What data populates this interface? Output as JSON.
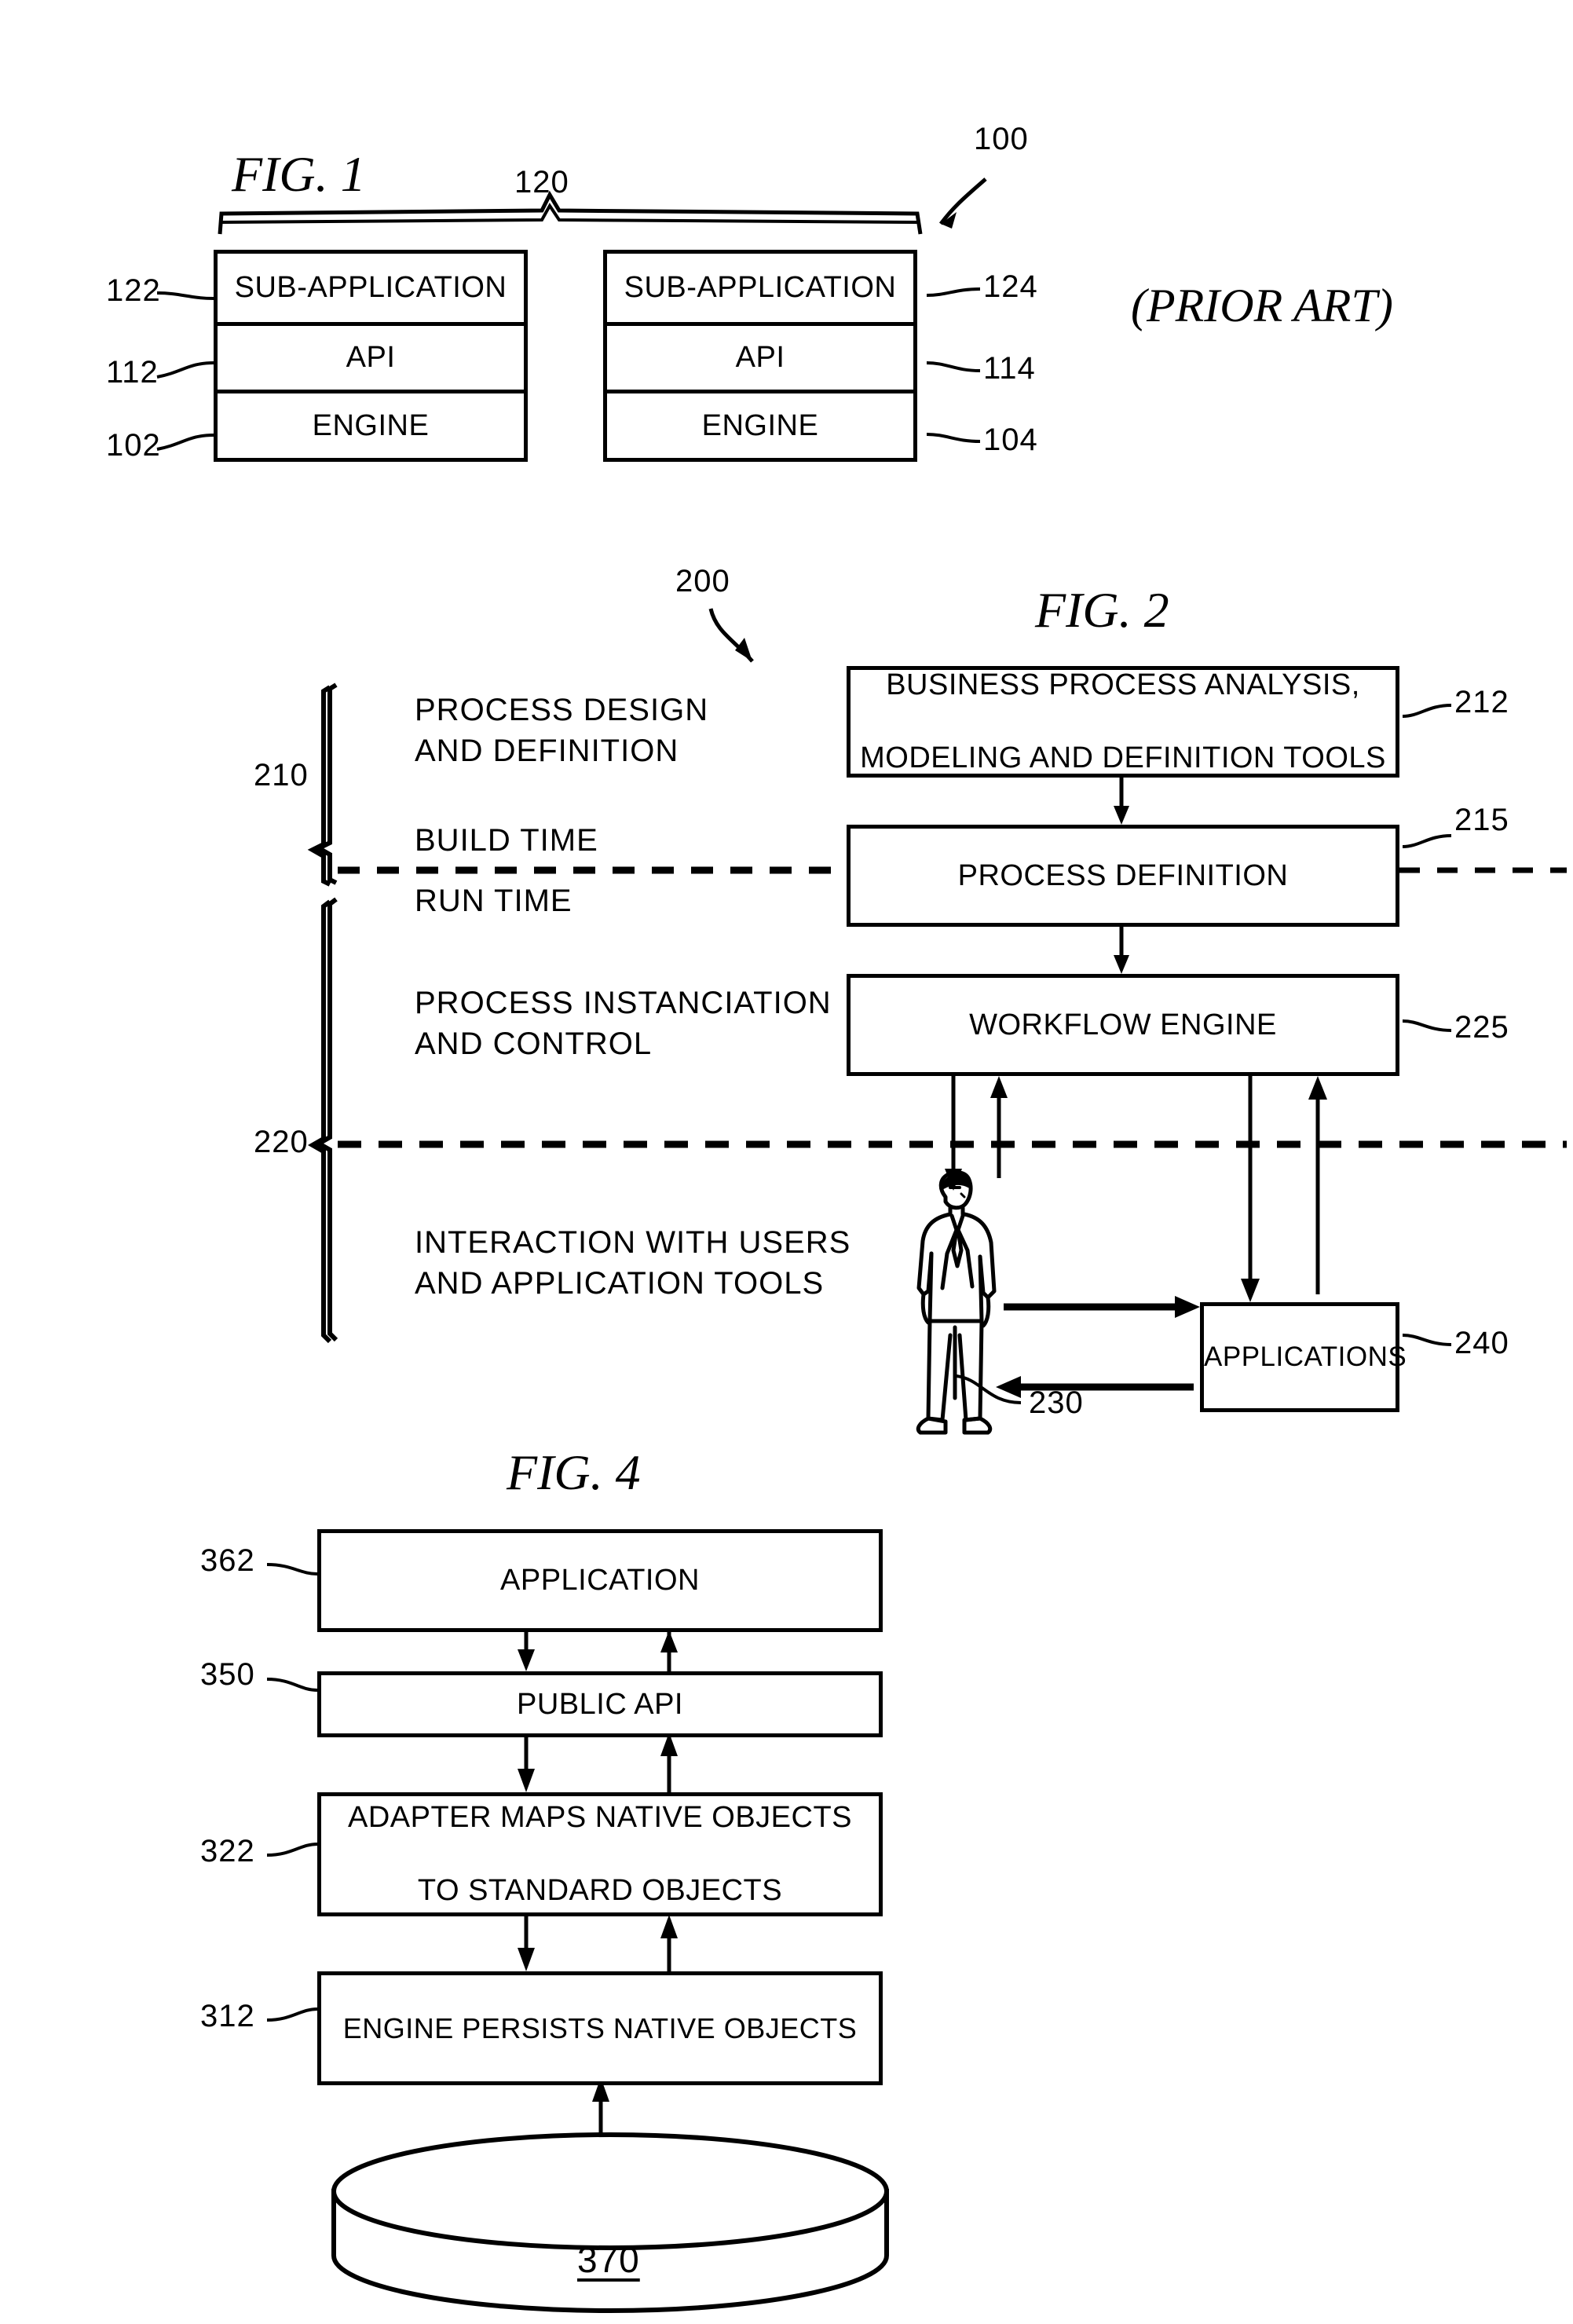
{
  "figures": [
    {
      "id": "fig1",
      "title": "FIG. 1",
      "note": "(PRIOR ART)",
      "brace_label": "120",
      "system_label": "100",
      "stacks": [
        {
          "cells": [
            {
              "label": "SUB-APPLICATION",
              "ref": "122",
              "ref_side": "left"
            },
            {
              "label": "API",
              "ref": "112",
              "ref_side": "left"
            },
            {
              "label": "ENGINE",
              "ref": "102",
              "ref_side": "left"
            }
          ]
        },
        {
          "cells": [
            {
              "label": "SUB-APPLICATION",
              "ref": "124",
              "ref_side": "right"
            },
            {
              "label": "API",
              "ref": "114",
              "ref_side": "right"
            },
            {
              "label": "ENGINE",
              "ref": "104",
              "ref_side": "right"
            }
          ]
        }
      ]
    },
    {
      "id": "fig2",
      "title": "FIG. 2",
      "system_label": "200",
      "brace_labels": [
        "210",
        "220"
      ],
      "phase_labels": [
        "PROCESS DESIGN\nAND DEFINITION",
        "BUILD TIME",
        "RUN TIME",
        "PROCESS INSTANCIATION\nAND CONTROL",
        "INTERACTION WITH USERS\nAND APPLICATION TOOLS"
      ],
      "phase_design_line1": "PROCESS DESIGN",
      "phase_design_line2": "AND DEFINITION",
      "phase_build_time": "BUILD TIME",
      "phase_run_time": "RUN TIME",
      "phase_instanciation_line1": "PROCESS INSTANCIATION",
      "phase_instanciation_line2": "AND CONTROL",
      "phase_interaction_line1": "INTERACTION WITH USERS",
      "phase_interaction_line2": "AND APPLICATION TOOLS",
      "boxes": [
        {
          "label_line1": "BUSINESS PROCESS ANALYSIS,",
          "label_line2": "MODELING AND DEFINITION TOOLS",
          "ref": "212"
        },
        {
          "label_line1": "PROCESS DEFINITION",
          "label_line2": "",
          "ref": "215"
        },
        {
          "label_line1": "WORKFLOW ENGINE",
          "label_line2": "",
          "ref": "225"
        },
        {
          "label_line1": "APPLICATIONS",
          "label_line2": "",
          "ref": "240"
        }
      ],
      "user_ref": "230"
    },
    {
      "id": "fig4",
      "title": "FIG. 4",
      "boxes": [
        {
          "label_line1": "APPLICATION",
          "label_line2": "",
          "ref": "362"
        },
        {
          "label_line1": "PUBLIC API",
          "label_line2": "",
          "ref": "350"
        },
        {
          "label_line1": "ADAPTER MAPS NATIVE OBJECTS",
          "label_line2": "TO STANDARD OBJECTS",
          "ref": "322"
        },
        {
          "label_line1": "ENGINE PERSISTS NATIVE OBJECTS",
          "label_line2": "",
          "ref": "312"
        }
      ],
      "datastore_label": "370"
    }
  ],
  "colors": {
    "ink": "#000000",
    "paper": "#ffffff"
  }
}
